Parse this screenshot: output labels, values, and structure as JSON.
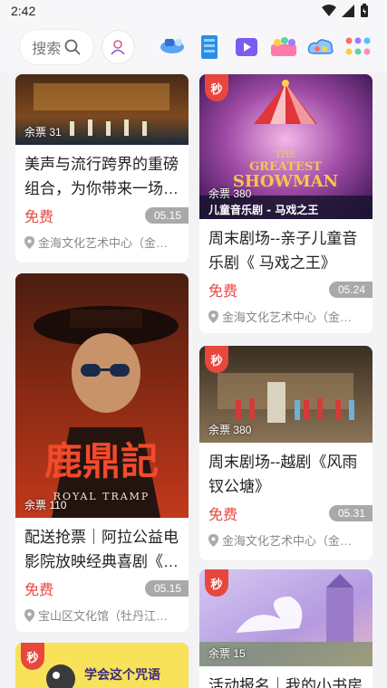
{
  "status": {
    "time": "2:42"
  },
  "header": {
    "search_label": "搜索"
  },
  "cards": [
    {
      "title": "美声与流行跨界的重磅组合，为你带来一场…",
      "tickets": "余票 31",
      "price": "免费",
      "date": "05.15",
      "venue": "金海文化艺术中心（金…",
      "seckill": false
    },
    {
      "title": "周末剧场--亲子儿童音乐剧《 马戏之王》",
      "tickets": "余票 380",
      "price": "免费",
      "date": "05.24",
      "venue": "金海文化艺术中心（金…",
      "seckill": true,
      "seckill_label": "秒",
      "poster_line1": "THE",
      "poster_line2": "GREATEST",
      "poster_line3": "SHOWMAN",
      "poster_caption": "儿童音乐剧 - 马戏之王"
    },
    {
      "title": "配送抢票｜阿拉公益电影院放映经典喜剧《…",
      "tickets": "余票 110",
      "price": "免费",
      "date": "05.15",
      "venue": "宝山区文化馆（牡丹江…",
      "seckill": false,
      "poster_title": "鹿鼎記",
      "poster_sub": "ROYAL TRAMP"
    },
    {
      "title": "周末剧场--越剧《风雨钗公塘》",
      "tickets": "余票 380",
      "price": "免费",
      "date": "05.31",
      "venue": "金海文化艺术中心（金…",
      "seckill": true,
      "seckill_label": "秒"
    },
    {
      "title": "活动报名｜我的小书房",
      "tickets": "余票 15",
      "seckill": true,
      "seckill_label": "秒"
    },
    {
      "title": "",
      "seckill": true,
      "seckill_label": "秒",
      "poster_text": "学会这个咒语"
    }
  ]
}
